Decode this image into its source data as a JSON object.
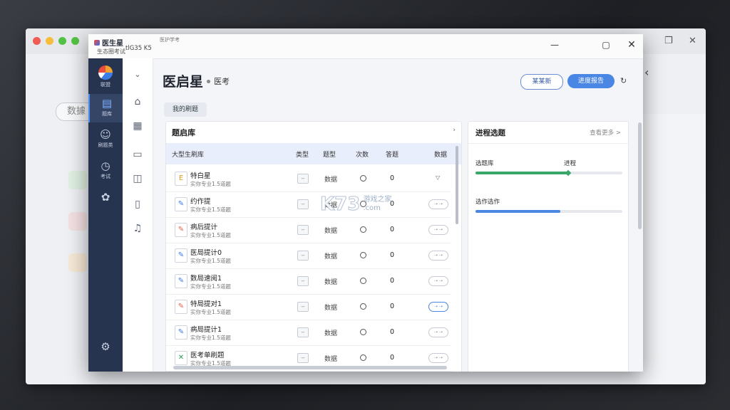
{
  "background": {
    "chip_label": "数據",
    "close_glyph": "‹"
  },
  "window": {
    "title": "医生星",
    "subtitle": "生态圈考试",
    "ip": "tlG35 K5",
    "center_text": "医护学考",
    "controls": {
      "minimize": "—",
      "maximize": "▢",
      "close": "✕"
    }
  },
  "rail": {
    "logo_label": "联盟",
    "items": [
      {
        "label": "题库",
        "icon": "book-icon",
        "active": true
      },
      {
        "label": "刷题类",
        "icon": "group-icon",
        "active": false
      },
      {
        "label": "考试",
        "icon": "clock-icon",
        "active": false
      },
      {
        "label": "",
        "icon": "brain-icon",
        "active": false
      }
    ],
    "settings_icon": "gear-icon"
  },
  "header": {
    "title": "医启星",
    "subtitle": "医考",
    "outline_button": "某某新",
    "primary_button": "进度报告"
  },
  "tabs": [
    "我的刷题"
  ],
  "library": {
    "title": "题启库",
    "columns": [
      "大型生刷库",
      "类型",
      "题型",
      "次数",
      "答题",
      "数据"
    ],
    "rows": [
      {
        "title": "特白星",
        "meta": "实你专业1.5道题",
        "type": "数据",
        "count": "0",
        "action": "triangle"
      },
      {
        "title": "约作提",
        "meta": "实你专业1.5道题",
        "type": "数据",
        "count": "0",
        "action": "toggle"
      },
      {
        "title": "病后提计",
        "meta": "实你专业1.5道题",
        "type": "数据",
        "count": "0",
        "action": "toggle"
      },
      {
        "title": "医局提计0",
        "meta": "实你专业1.5道题",
        "type": "数据",
        "count": "0",
        "action": "toggle"
      },
      {
        "title": "数局速阅1",
        "meta": "实你专业1.5道题",
        "type": "数据",
        "count": "0",
        "action": "toggle"
      },
      {
        "title": "特局提对1",
        "meta": "实你专业1.5道题",
        "type": "数据",
        "count": "0",
        "action": "toggle-on"
      },
      {
        "title": "病局提计1",
        "meta": "实你专业1.5道题",
        "type": "数据",
        "count": "0",
        "action": "toggle"
      },
      {
        "title": "医考单刷题",
        "meta": "实你专业1.5道题",
        "type": "数据",
        "count": "0",
        "action": "toggle"
      }
    ]
  },
  "progress": {
    "title": "进程选题",
    "link": "查看更多 >",
    "bars": [
      {
        "label": "选题库",
        "label2": "进程",
        "value": 0.63,
        "color": "#3aa76a"
      },
      {
        "label": "选作选作",
        "value": 0.58,
        "color": "#4a86e4"
      }
    ]
  },
  "watermark": {
    "brand": "K73",
    "cn": "游戏之家",
    "domain": ".com"
  }
}
